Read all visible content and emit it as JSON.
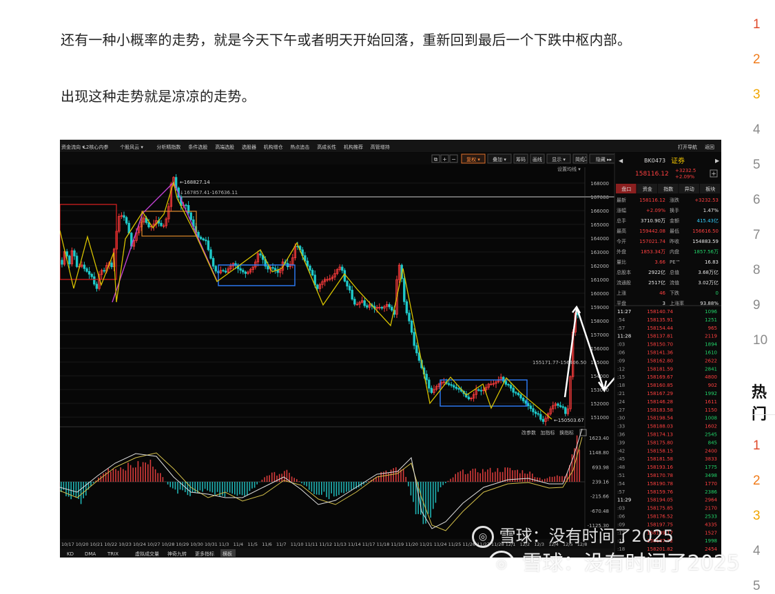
{
  "article": {
    "para1": "还有一种小概率的走势，就是今天下午或者明天开始回落，重新回到最后一个下跌中枢内部。",
    "para2": "出现这种走势就是凉凉的走势。"
  },
  "right_rail": {
    "numbers": [
      "1",
      "2",
      "3",
      "4",
      "5",
      "6",
      "7",
      "8",
      "9",
      "10"
    ],
    "hot_title": "热门",
    "hot_numbers": [
      "1",
      "2",
      "3",
      "4",
      "5"
    ]
  },
  "app": {
    "toolbar": [
      "L2核心内参",
      "个股风云 ▾",
      "分析精指数",
      "条件选股",
      "高端选股",
      "选股器",
      "机构增仓",
      "热点追击",
      "高成长性",
      "机构推荐",
      "高管增持"
    ],
    "toolbar_left": "资金流向 ▾",
    "toolbar_right": [
      "打开导航",
      "返回"
    ],
    "chart_buttons": [
      "复权 ▾",
      "叠加 ▾",
      "筹码",
      "画线",
      "显示 ▾",
      "简约",
      "隐藏 ▸▸"
    ],
    "chart_setting": "设置均线 ▾",
    "indicator_buttons": [
      "改参数",
      "加指标",
      "换指标"
    ],
    "bottom_tabs": [
      "KD",
      "DMA",
      "TRIX",
      "虚拟成交量",
      "神奇九转",
      "更多指标",
      "横板"
    ]
  },
  "quote": {
    "code": "BK0473",
    "name": "证券",
    "price": "158116.12",
    "change": "+3232.5",
    "change_pct": "+2.09%",
    "tabs": [
      "盘口",
      "资金",
      "指数",
      "异动",
      "板块"
    ],
    "rows": [
      [
        "最新",
        "158116.12",
        "涨跌",
        "+3232.53"
      ],
      [
        "涨幅",
        "+2.09%",
        "换手",
        "1.47%"
      ],
      [
        "总手",
        "3710.90万",
        "金额",
        "415.43亿"
      ],
      [
        "最高",
        "159442.08",
        "最低",
        "156616.50"
      ],
      [
        "今开",
        "157021.74",
        "昨收",
        "154883.59"
      ],
      [
        "外盘",
        "1853.34万",
        "内盘",
        "1857.56万"
      ],
      [
        "量比",
        "3.66",
        "PE™",
        "16.83"
      ],
      [
        "总股本",
        "2922亿",
        "总值",
        "3.68万亿"
      ],
      [
        "流通股",
        "2517亿",
        "流值",
        "3.02万亿"
      ],
      [
        "上涨",
        "46",
        "下跌",
        "0"
      ],
      [
        "平盘",
        "3",
        "上涨率",
        "93.88%"
      ]
    ],
    "ticks": [
      [
        "11:27",
        "158140.74",
        "1096"
      ],
      [
        ":54",
        "158135.91",
        "1251"
      ],
      [
        ":57",
        "158154.44",
        "965"
      ],
      [
        "11:28",
        "158137.81",
        "2119"
      ],
      [
        ":03",
        "158150.70",
        "1894"
      ],
      [
        ":06",
        "158141.36",
        "1610"
      ],
      [
        ":09",
        "158162.80",
        "2622"
      ],
      [
        ":12",
        "158181.59",
        "2841"
      ],
      [
        ":15",
        "158169.67",
        "4800"
      ],
      [
        ":18",
        "158160.85",
        "902"
      ],
      [
        ":21",
        "158167.29",
        "1992"
      ],
      [
        ":24",
        "158146.28",
        "1611"
      ],
      [
        ":27",
        "158183.58",
        "1150"
      ],
      [
        ":30",
        "158198.54",
        "1008"
      ],
      [
        ":33",
        "158188.03",
        "1602"
      ],
      [
        ":36",
        "158174.13",
        "2545"
      ],
      [
        ":39",
        "158175.80",
        "845"
      ],
      [
        ":42",
        "158158.15",
        "2400"
      ],
      [
        ":45",
        "158181.58",
        "3833"
      ],
      [
        ":48",
        "158193.16",
        "1775"
      ],
      [
        ":51",
        "158170.78",
        "3498"
      ],
      [
        ":54",
        "158190.78",
        "1770"
      ],
      [
        ":57",
        "158159.76",
        "2386"
      ],
      [
        "11:29",
        "158194.05",
        "2964"
      ],
      [
        ":03",
        "158175.85",
        "2170"
      ],
      [
        ":06",
        "158176.52",
        "2533"
      ],
      [
        ":09",
        "158197.75",
        "4335"
      ],
      [
        ":12",
        "158189.17",
        "1527"
      ],
      [
        ":15",
        "158187.72",
        "1998"
      ],
      [
        ":18",
        "158201.82",
        "2454"
      ]
    ]
  },
  "chart_data": {
    "type": "candlestick",
    "y_ticks": [
      "168000",
      "167000",
      "166000",
      "165000",
      "164000",
      "163000",
      "162000",
      "161000",
      "160000",
      "159000",
      "158000",
      "157000",
      "156000",
      "155000",
      "154000",
      "153000",
      "152000",
      "151000"
    ],
    "macd_ticks": [
      "1623.40",
      "1148.80",
      "693.98",
      "239.16",
      "-215.66",
      "-670.48",
      "-1125.30"
    ],
    "x_labels": [
      "10/17",
      "10/20",
      "10/21",
      "10/22",
      "10/23",
      "10/24",
      "10/27",
      "10/28",
      "10/29",
      "10/30",
      "10/31",
      "11/3",
      "11/4",
      "11/5",
      "11/6",
      "11/7",
      "11/10",
      "11/11",
      "11/12",
      "11/13",
      "11/14",
      "11/17",
      "11/18",
      "11/19",
      "11/20",
      "11/21",
      "11/24",
      "11/25",
      "11/26",
      "11/27",
      "11/28",
      "12/1",
      "12/2",
      "12/3",
      "12/4",
      "12/5",
      "12/8"
    ],
    "annotations": {
      "high_label": "168827.14",
      "range_label": "167857.41-167636.11",
      "low_label": "150503.67",
      "mid_label": "155171.77-156406.50"
    },
    "colors": {
      "up": "#ff3d3d",
      "down": "#1ec9c9",
      "zigzag": "#d7c200",
      "pivot": "#2f7fff",
      "macd_up": "#d83b3b",
      "macd_down": "#1fb3b3"
    }
  },
  "watermark": {
    "line1": "雪球：没有时间了2025",
    "line2": "雪球：没有时间了2025"
  }
}
